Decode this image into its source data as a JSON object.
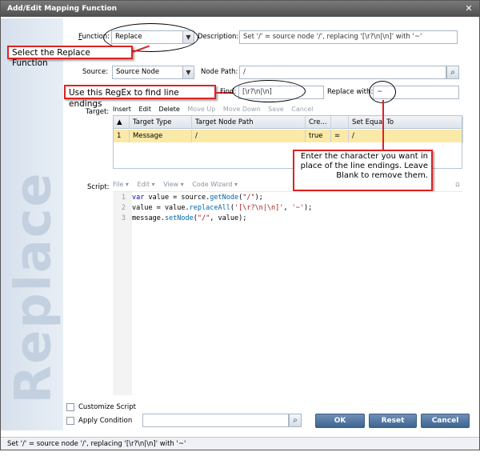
{
  "window": {
    "title": "Add/Edit Mapping Function",
    "close_glyph": "✕"
  },
  "watermark": "Replace",
  "function": {
    "label_prefix": "F",
    "label_rest": "unction:",
    "value": "Replace"
  },
  "description": {
    "label": "Description:",
    "value": "Set '/' = source node '/', replacing '[\\r?\\n|\\n]' with '~'"
  },
  "source": {
    "label": "Source:",
    "value": "Source Node"
  },
  "node_path": {
    "label": "Node Path:",
    "value": "/"
  },
  "find": {
    "label": "Find:",
    "value": "[\\r?\\n|\\n]"
  },
  "replace_with": {
    "label": "Replace with:",
    "value": "~"
  },
  "target": {
    "label": "Target:",
    "toolbar": [
      "Insert",
      "Edit",
      "Delete",
      "Move Up",
      "Move Down",
      "Save",
      "Cancel"
    ],
    "columns": [
      "",
      "Target Type",
      "Target Node Path",
      "Cre...",
      "",
      "Set Equal To"
    ],
    "rows": [
      {
        "num": "1",
        "type": "Message",
        "path": "/",
        "create": "true",
        "op": "=",
        "value": "/"
      }
    ]
  },
  "script": {
    "label": "Script:",
    "toolbar": [
      "File ▾",
      "Edit ▾",
      "View ▾",
      "Code Wizard ▾"
    ],
    "lines": [
      {
        "num": "1",
        "code": "var value = source.getNode(\"/\");"
      },
      {
        "num": "2",
        "code": "value = value.replaceAll('[\\r?\\n|\\n]', '~');"
      },
      {
        "num": "3",
        "code": "message.setNode(\"/\", value);"
      }
    ]
  },
  "options": {
    "customize_script": "Customize Script",
    "apply_condition": "Apply Condition"
  },
  "buttons": {
    "ok": "OK",
    "reset": "Reset",
    "cancel": "Cancel"
  },
  "status": "Set '/' = source node '/', replacing '[\\r?\\n|\\n]' with '~'",
  "callouts": {
    "select_function": "Select the Replace Function",
    "regex": "Use this RegEx to find line endings",
    "replace_char": "Enter the character you want in place of the line endings. Leave Blank to remove them."
  },
  "colors": {
    "callout_border": "#dd2222",
    "button": "#4a6f9c",
    "row_highlight": "#fbe9a8"
  }
}
